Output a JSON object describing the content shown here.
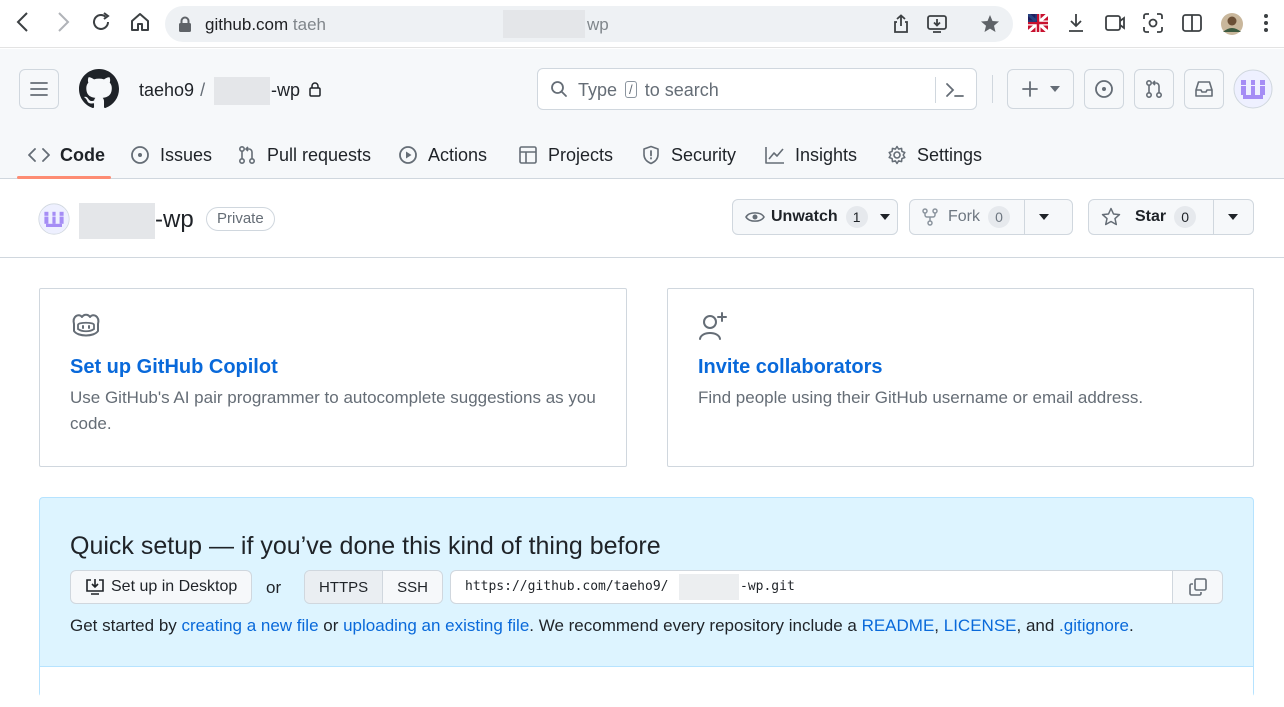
{
  "browser": {
    "domain": "github.com",
    "path_start": "taeh",
    "path_end": "wp"
  },
  "header": {
    "owner": "taeho9",
    "separator": "/",
    "repo": "-wp",
    "search_placeholder_pre": "Type",
    "search_slash": "/",
    "search_placeholder_post": "to search"
  },
  "tabs": [
    {
      "label": "Code",
      "icon": "code-icon"
    },
    {
      "label": "Issues",
      "icon": "issue-icon"
    },
    {
      "label": "Pull requests",
      "icon": "pull-request-icon"
    },
    {
      "label": "Actions",
      "icon": "play-icon"
    },
    {
      "label": "Projects",
      "icon": "table-icon"
    },
    {
      "label": "Security",
      "icon": "shield-icon"
    },
    {
      "label": "Insights",
      "icon": "graph-icon"
    },
    {
      "label": "Settings",
      "icon": "gear-icon"
    }
  ],
  "repo": {
    "name": "-wp",
    "visibility": "Private",
    "unwatch_label": "Unwatch",
    "watch_count": "1",
    "fork_label": "Fork",
    "fork_count": "0",
    "star_label": "Star",
    "star_count": "0"
  },
  "cards": {
    "copilot": {
      "title": "Set up GitHub Copilot",
      "desc": "Use GitHub's AI pair programmer to autocomplete suggestions as you code."
    },
    "invite": {
      "title": "Invite collaborators",
      "desc": "Find people using their GitHub username or email address."
    }
  },
  "quick_setup": {
    "heading": "Quick setup — if you’ve done this kind of thing before",
    "desktop_button": "Set up in Desktop",
    "or": "or",
    "https": "HTTPS",
    "ssh": "SSH",
    "url_prefix": "https://github.com/taeho9/",
    "url_suffix": "-wp.git",
    "help_1": "Get started by ",
    "link_new_file": "creating a new file",
    "help_2": " or ",
    "link_upload": "uploading an existing file",
    "help_3": ". We recommend every repository include a ",
    "link_readme": "README",
    "help_4": ", ",
    "link_license": "LICENSE",
    "help_5": ", and ",
    "link_gitignore": ".gitignore",
    "help_6": "."
  },
  "colors": {
    "link": "#0969da",
    "tab_underline": "#fd8c73",
    "quick_setup_bg": "#ddf4ff"
  }
}
